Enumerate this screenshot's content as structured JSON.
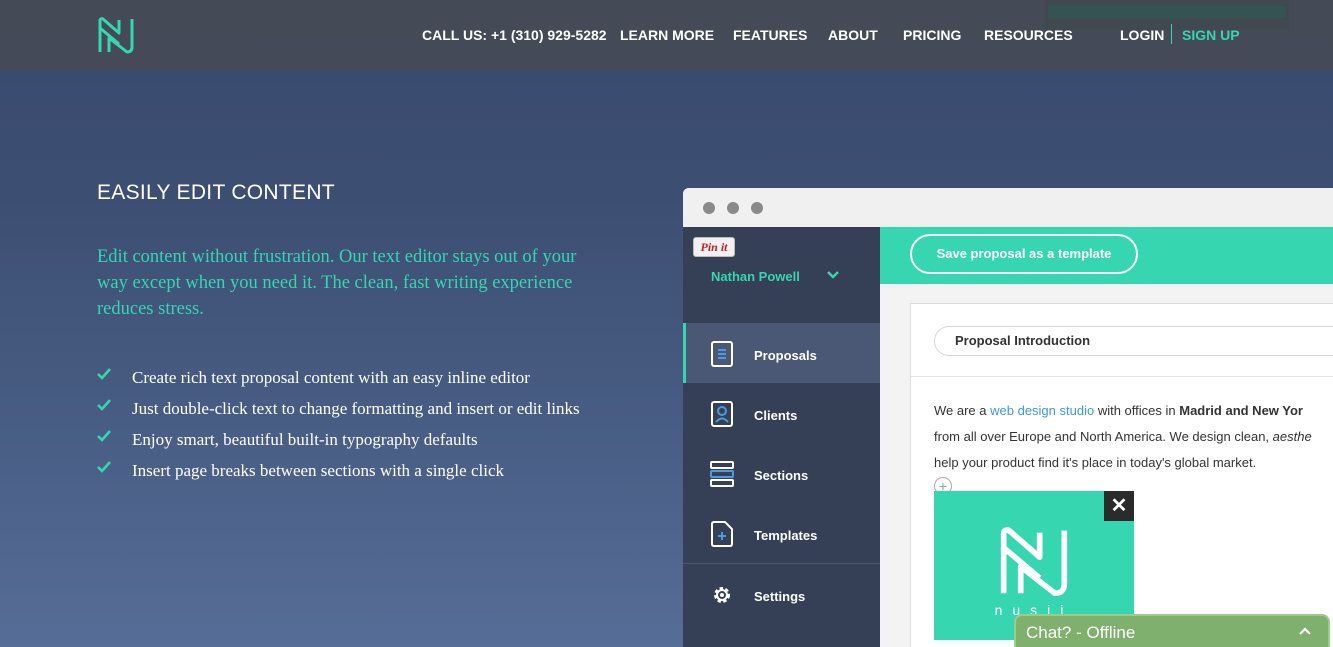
{
  "nav": {
    "call_us": "CALL US: +1 (310) 929-5282",
    "links": [
      "LEARN MORE",
      "FEATURES",
      "ABOUT",
      "PRICING",
      "RESOURCES"
    ],
    "login": "LOGIN",
    "signup": "SIGN UP"
  },
  "hero": {
    "title": "EASILY EDIT CONTENT",
    "lead": "Edit content without frustration. Our text editor stays out of your way except when you need it. The clean, fast writing experience reduces stress.",
    "features": [
      "Create rich text proposal content with an easy inline editor",
      "Just double-click text to change formatting and insert or edit links",
      "Enjoy smart, beautiful built-in typography defaults",
      "Insert page breaks between sections with a single click"
    ]
  },
  "app": {
    "pinit": "Pin it",
    "user_name": "Nathan Powell",
    "sidebar": [
      {
        "label": "Proposals",
        "icon": "document-icon"
      },
      {
        "label": "Clients",
        "icon": "client-card-icon"
      },
      {
        "label": "Sections",
        "icon": "sections-icon"
      },
      {
        "label": "Templates",
        "icon": "template-icon"
      },
      {
        "label": "Settings",
        "icon": "gear-icon"
      }
    ],
    "active_item": "Proposals",
    "save_button": "Save proposal as a template",
    "section_title": "Proposal Introduction",
    "para": {
      "l1_a": "We are a ",
      "l1_link": "web design studio",
      "l1_b": " with offices in ",
      "l1_bold": "Madrid and New Yor",
      "l2_a": "from all over Europe and North America. We design clean, ",
      "l2_em": "aesthe",
      "l3": "help your product find it's place in today's global market."
    },
    "plus": "+",
    "close": "✕",
    "image_caption": "nusii"
  },
  "chat": {
    "label": "Chat? - Offline"
  },
  "colors": {
    "accent": "#35d6b0",
    "bg_top": "#394a6c",
    "sidebar": "#353f55",
    "chat": "#7fb06d"
  }
}
